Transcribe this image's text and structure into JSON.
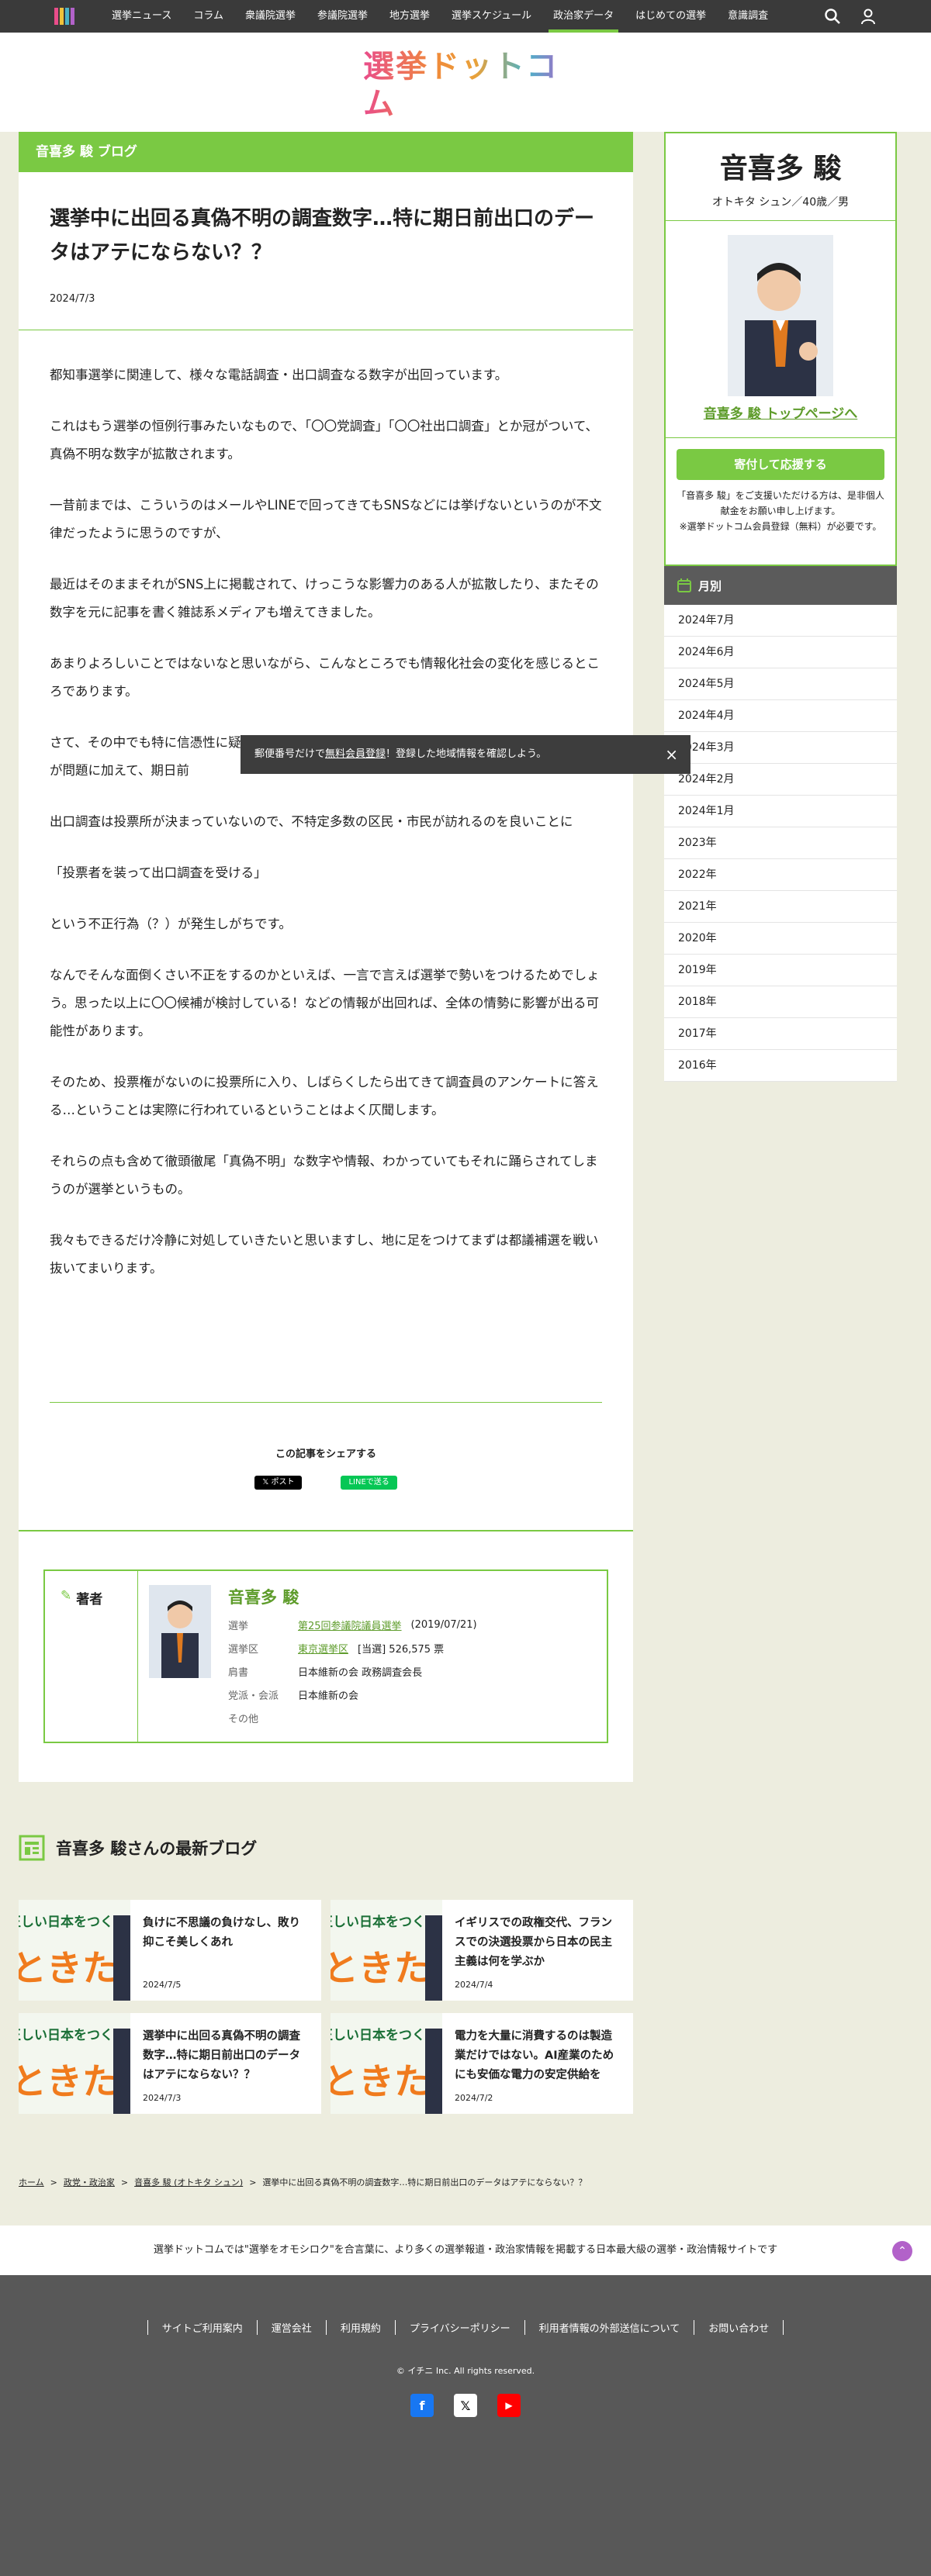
{
  "nav": {
    "items": [
      "選挙ニュース",
      "コラム",
      "衆議院選挙",
      "参議院選挙",
      "地方選挙",
      "選挙スケジュール",
      "政治家データ",
      "はじめての選挙",
      "意識調査"
    ],
    "active_index": 6
  },
  "logo": {
    "text": "選挙ドットコム"
  },
  "article": {
    "blog_label": "音喜多 駿 ブログ",
    "title": "選挙中に出回る真偽不明の調査数字…特に期日前出口のデータはアテにならない？？",
    "date": "2024/7/3",
    "paragraphs": [
      "都知事選挙に関連して、様々な電話調査・出口調査なる数字が出回っています。",
      "これはもう選挙の恒例行事みたいなもので、「〇〇党調査」「〇〇社出口調査」とか冠がついて、真偽不明な数字が拡散されます。",
      "一昔前までは、こういうのはメールやLINEで回ってきてもSNSなどには挙げないというのが不文律だったように思うのですが、",
      "最近はそのままそれがSNS上に掲載されて、けっこうな影響力のある人が拡散したり、またその数字を元に記事を書く雑誌系メディアも増えてきました。",
      "あまりよろしいことではないなと思いながら、こんなところでも情報化社会の変化を感じるところであります。",
      "さて、その中でも特に信憑性に疑問符がつくのが期日前の出口調査数字で、そもそも本物なのかが問題に加えて、期日前",
      "出口調査は投票所が決まっていないので、不特定多数の区民・市民が訪れるのを良いことに",
      "「投票者を装って出口調査を受ける」",
      "という不正行為（？）が発生しがちです。",
      "なんでそんな面倒くさい不正をするのかといえば、一言で言えば選挙で勢いをつけるためでしょう。思った以上に〇〇候補が検討している！などの情報が出回れば、全体の情勢に影響が出る可能性があります。",
      "そのため、投票権がないのに投票所に入り、しばらくしたら出てきて調査員のアンケートに答える…ということは実際に行われているということはよく仄聞します。",
      "それらの点も含めて徹頭徹尾「真偽不明」な数字や情報、わかっていてもそれに踊らされてしまうのが選挙というもの。",
      "我々もできるだけ冷静に対処していきたいと思いますし、地に足をつけてまずは都議補選を戦い抜いてまいります。"
    ],
    "share_label": "この記事をシェアする",
    "share_x": "ポスト",
    "share_line": "LINEで送る"
  },
  "author": {
    "label": "著者",
    "name": "音喜多 駿",
    "rows": {
      "election_k": "選挙",
      "election_v": "第25回参議院議員選挙",
      "election_date": "(2019/07/21)",
      "district_k": "選挙区",
      "district_v": "東京選挙区",
      "district_result": "[当選] 526,575 票",
      "title_k": "肩書",
      "title_v": "日本維新の会 政務調査会長",
      "party_k": "党派・会派",
      "party_v": "日本維新の会",
      "other_k": "その他"
    }
  },
  "sidebar": {
    "name": "音喜多 駿",
    "sub": "オトキタ シュン／40歳／男",
    "top_link": "音喜多 駿 トップページへ",
    "donate": "寄付して応援する",
    "donate_note": "「音喜多 駿」をご支援いただける方は、是非個人献金をお願い申し上げます。\n※選挙ドットコム会員登録（無料）が必要です。",
    "archive_title": "月別",
    "archive": [
      "2024年7月",
      "2024年6月",
      "2024年5月",
      "2024年4月",
      "2024年3月",
      "2024年2月",
      "2024年1月",
      "2023年",
      "2022年",
      "2021年",
      "2020年",
      "2019年",
      "2018年",
      "2017年",
      "2016年"
    ]
  },
  "toast": {
    "prefix": "郵便番号だけで",
    "link": "無料会員登録",
    "suffix": "！登録した地域情報を確認しよう。",
    "close": "×"
  },
  "latest": {
    "title": "音喜多 駿さんの最新ブログ",
    "thumb_text1": "正しい日本をつくろう",
    "thumb_text2": "ときた駿",
    "cards": [
      {
        "title": "負けに不思議の負けなし、敗り抑こそ美しくあれ",
        "date": "2024/7/5"
      },
      {
        "title": "イギリスでの政権交代、フランスでの決選投票から日本の民主主義は何を学ぶか",
        "date": "2024/7/4"
      },
      {
        "title": "選挙中に出回る真偽不明の調査数字…特に期日前出口のデータはアテにならない？？",
        "date": "2024/7/3"
      },
      {
        "title": "電力を大量に消費するのは製造業だけではない。AI産業のためにも安価な電力の安定供給を",
        "date": "2024/7/2"
      }
    ]
  },
  "breadcrumb": [
    "ホーム",
    "政党・政治家",
    "音喜多 駿 (オトキタ シュン)",
    "選挙中に出回る真偽不明の調査数字…特に期日前出口のデータはアテにならない？？"
  ],
  "tagline": "選挙ドットコムでは\"選挙をオモシロク\"を合言葉に、より多くの選挙報道・政治家情報を掲載する日本最大級の選挙・政治情報サイトです",
  "footer": {
    "links": [
      "サイトご利用案内",
      "運営会社",
      "利用規約",
      "プライバシーポリシー",
      "利用者情報の外部送信について",
      "お問い合わせ"
    ],
    "copyright": "© イチニ Inc. All rights reserved."
  },
  "colors": {
    "accent": "#7ac943",
    "link": "#5e9c2b",
    "nav_bg": "#3a3a3a",
    "footer_bg": "#585858",
    "page_bg": "#ededdf"
  }
}
